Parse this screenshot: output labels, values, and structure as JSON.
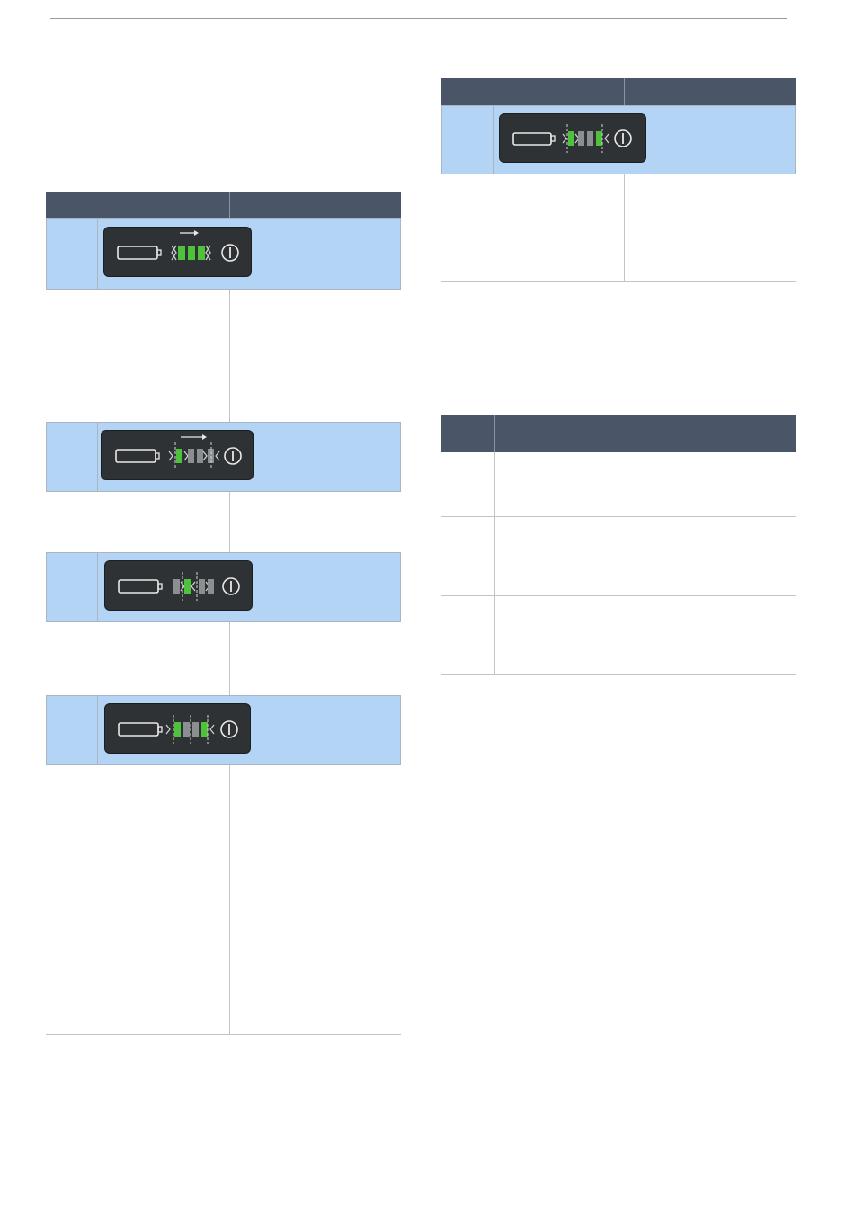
{
  "document": {
    "header_rule": true
  },
  "colors": {
    "header_fill": "#4a5568",
    "band_fill": "#b3d4f5",
    "panel_fill": "#2f3234",
    "led_green": "#4ec23a",
    "led_gray": "#8c8f92",
    "rule": "#c4c4c4"
  },
  "indicator_panels": [
    {
      "id": "left-1",
      "icons": [
        "battery-icon",
        "charging-arrow-icon",
        "led-bar-all-green-icon",
        "power-icon"
      ]
    },
    {
      "id": "left-2",
      "icons": [
        "battery-icon",
        "charging-arrow-icon",
        "led-bar-first-green-flashing-icon",
        "power-icon"
      ]
    },
    {
      "id": "left-3",
      "icons": [
        "battery-icon",
        "led-bar-second-green-flashing-icon",
        "power-icon"
      ]
    },
    {
      "id": "left-4",
      "icons": [
        "battery-icon",
        "led-bar-alternating-flashing-icon",
        "power-icon"
      ]
    },
    {
      "id": "right-1",
      "icons": [
        "battery-icon",
        "led-bar-outer-green-flashing-icon",
        "power-icon"
      ]
    }
  ]
}
